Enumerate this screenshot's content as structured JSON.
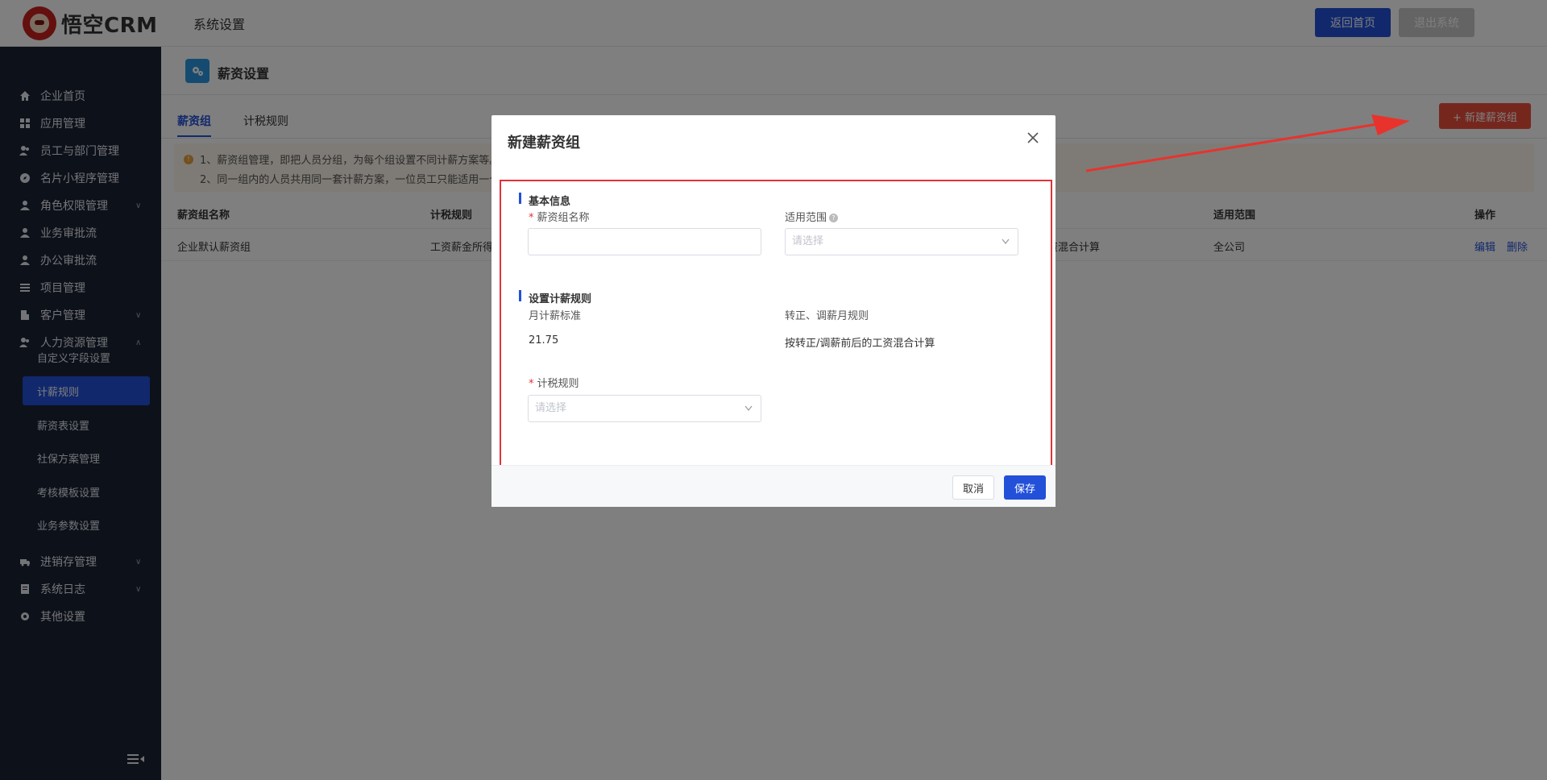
{
  "header": {
    "logo_text": "悟空CRM",
    "title": "系统设置",
    "home_button": "返回首页",
    "exit_button": "退出系统"
  },
  "sidebar": {
    "items": [
      {
        "label": "企业首页",
        "icon": "home-icon"
      },
      {
        "label": "应用管理",
        "icon": "grid-icon"
      },
      {
        "label": "员工与部门管理",
        "icon": "users-icon"
      },
      {
        "label": "名片小程序管理",
        "icon": "compass-icon"
      },
      {
        "label": "角色权限管理",
        "icon": "user-icon"
      },
      {
        "label": "业务审批流",
        "icon": "user-icon"
      },
      {
        "label": "办公审批流",
        "icon": "user-icon"
      },
      {
        "label": "项目管理",
        "icon": "list-icon"
      },
      {
        "label": "客户管理",
        "icon": "building-icon"
      },
      {
        "label": "人力资源管理",
        "icon": "users-icon"
      },
      {
        "label": "进销存管理",
        "icon": "truck-icon"
      },
      {
        "label": "系统日志",
        "icon": "doc-icon"
      },
      {
        "label": "其他设置",
        "icon": "gear-icon"
      }
    ],
    "sub_items": [
      "自定义字段设置",
      "计薪规则",
      "薪资表设置",
      "社保方案管理",
      "考核模板设置",
      "业务参数设置"
    ]
  },
  "page": {
    "title": "薪资设置",
    "tabs": [
      "薪资组",
      "计税规则"
    ],
    "new_button": "新建薪资组",
    "notices": [
      "1、薪资组管理，即把人员分组，为每个组设置不同计薪方案等。",
      "2、同一组内的人员共用同一套计薪方案，一位员工只能适用一个"
    ],
    "table": {
      "headers": [
        "薪资组名称",
        "计税规则",
        "适用范围",
        "操作"
      ],
      "row": {
        "name": "企业默认薪资组",
        "tax_rule": "工资薪金所得",
        "mixed": "资混合计算",
        "scope": "全公司",
        "edit": "编辑",
        "delete": "删除"
      }
    }
  },
  "modal": {
    "title": "新建薪资组",
    "section_basic": "基本信息",
    "name_label": "薪资组名称",
    "scope_label": "适用范围",
    "scope_placeholder": "请选择",
    "section_rules": "设置计薪规则",
    "monthly_label": "月计薪标准",
    "monthly_value": "21.75",
    "adjust_label": "转正、调薪月规则",
    "adjust_value": "按转正/调薪前后的工资混合计算",
    "tax_label": "计税规则",
    "tax_placeholder": "请选择",
    "cancel": "取消",
    "save": "保存"
  }
}
